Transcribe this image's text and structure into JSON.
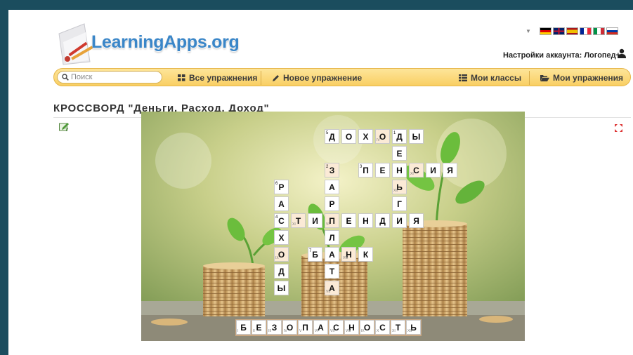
{
  "header": {
    "logo_text": "LearningApps.org",
    "account_label": "Настройки аккаунта: Логопед+",
    "languages": [
      {
        "code": "de",
        "colors": [
          "#000000",
          "#dd0000",
          "#ffce00"
        ]
      },
      {
        "code": "en",
        "colors": [
          "#012169",
          "#ffffff",
          "#c8102e"
        ]
      },
      {
        "code": "es",
        "colors": [
          "#aa151b",
          "#f1bf00",
          "#aa151b"
        ]
      },
      {
        "code": "fr",
        "colors": [
          "#002395",
          "#ffffff",
          "#ed2939"
        ]
      },
      {
        "code": "it",
        "colors": [
          "#009246",
          "#ffffff",
          "#ce2b37"
        ]
      },
      {
        "code": "ru",
        "colors": [
          "#ffffff",
          "#0039a6",
          "#d52b1e"
        ]
      }
    ]
  },
  "navbar": {
    "search_placeholder": "Поиск",
    "all_exercises": "Все упражнения",
    "new_exercise": "Новое упражнение",
    "my_classes": "Мои классы",
    "my_exercises": "Мои упражнения"
  },
  "page": {
    "title": "КРОССВОРД \"Деньги. Расход. Доход\""
  },
  "crossword": {
    "cells": [
      {
        "r": 0,
        "c": 5,
        "l": "Д",
        "n": "5"
      },
      {
        "r": 0,
        "c": 6,
        "l": "О"
      },
      {
        "r": 0,
        "c": 7,
        "l": "Х"
      },
      {
        "r": 0,
        "c": 8,
        "l": "О",
        "h": true,
        "s": "IV"
      },
      {
        "r": 0,
        "c": 9,
        "l": "Д",
        "n": "1"
      },
      {
        "r": 0,
        "c": 10,
        "l": "Ы"
      },
      {
        "r": 1,
        "c": 9,
        "l": "Е"
      },
      {
        "r": 2,
        "c": 5,
        "l": "З",
        "n": "2",
        "h": true
      },
      {
        "r": 2,
        "c": 7,
        "l": "П",
        "n": "3"
      },
      {
        "r": 2,
        "c": 8,
        "l": "Е"
      },
      {
        "r": 2,
        "c": 9,
        "l": "Н"
      },
      {
        "r": 2,
        "c": 10,
        "l": "С",
        "h": true,
        "s": "XI"
      },
      {
        "r": 2,
        "c": 11,
        "l": "И"
      },
      {
        "r": 2,
        "c": 12,
        "l": "Я"
      },
      {
        "r": 3,
        "c": 2,
        "l": "Р",
        "n": "6"
      },
      {
        "r": 3,
        "c": 5,
        "l": "А"
      },
      {
        "r": 3,
        "c": 9,
        "l": "Ь",
        "h": true,
        "s": "XII"
      },
      {
        "r": 4,
        "c": 2,
        "l": "А"
      },
      {
        "r": 4,
        "c": 5,
        "l": "Р"
      },
      {
        "r": 4,
        "c": 9,
        "l": "Г"
      },
      {
        "r": 5,
        "c": 2,
        "l": "С",
        "n": "4"
      },
      {
        "r": 5,
        "c": 3,
        "l": "Т",
        "h": true,
        "s": "XI"
      },
      {
        "r": 5,
        "c": 4,
        "l": "И"
      },
      {
        "r": 5,
        "c": 5,
        "l": "П",
        "h": true,
        "s": "VI"
      },
      {
        "r": 5,
        "c": 6,
        "l": "Е"
      },
      {
        "r": 5,
        "c": 7,
        "l": "Н"
      },
      {
        "r": 5,
        "c": 8,
        "l": "Д"
      },
      {
        "r": 5,
        "c": 9,
        "l": "И"
      },
      {
        "r": 5,
        "c": 10,
        "l": "Я"
      },
      {
        "r": 6,
        "c": 2,
        "l": "Х"
      },
      {
        "r": 6,
        "c": 5,
        "l": "Л"
      },
      {
        "r": 7,
        "c": 2,
        "l": "О",
        "h": true,
        "s": "IX"
      },
      {
        "r": 7,
        "c": 4,
        "l": "Б",
        "n": "7"
      },
      {
        "r": 7,
        "c": 5,
        "l": "А"
      },
      {
        "r": 7,
        "c": 6,
        "l": "Н",
        "h": true,
        "s": "VIII"
      },
      {
        "r": 7,
        "c": 7,
        "l": "К"
      },
      {
        "r": 8,
        "c": 2,
        "l": "Д"
      },
      {
        "r": 8,
        "c": 5,
        "l": "Т"
      },
      {
        "r": 9,
        "c": 2,
        "l": "Ы"
      },
      {
        "r": 9,
        "c": 5,
        "l": "А",
        "h": true,
        "s": "VII"
      }
    ],
    "answer": [
      {
        "l": "Б",
        "s": "I"
      },
      {
        "l": "Е",
        "s": "II"
      },
      {
        "l": "З",
        "s": "III"
      },
      {
        "l": "О",
        "s": "IV"
      },
      {
        "l": "П",
        "s": "V"
      },
      {
        "l": "А",
        "s": "VI"
      },
      {
        "l": "С",
        "s": "VII"
      },
      {
        "l": "Н",
        "s": "VIII"
      },
      {
        "l": "О",
        "s": "IX"
      },
      {
        "l": "С",
        "s": "X"
      },
      {
        "l": "Т",
        "s": "XI"
      },
      {
        "l": "Ь",
        "s": "XII"
      }
    ]
  }
}
